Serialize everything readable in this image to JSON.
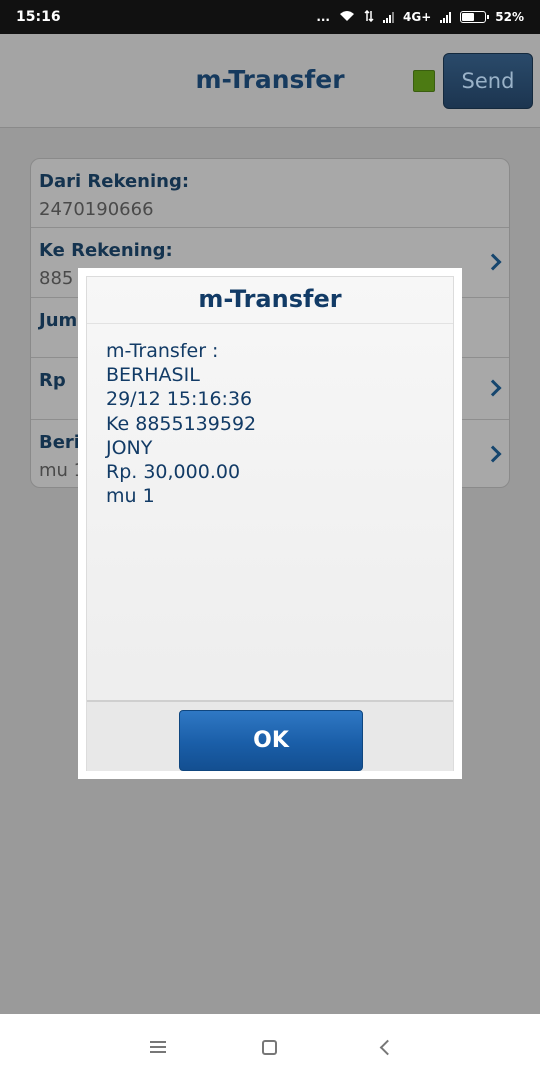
{
  "status_bar": {
    "time": "15:16",
    "dots": "...",
    "network": "4G+",
    "battery": "52%"
  },
  "app": {
    "title": "m-Transfer",
    "send_label": "Send",
    "fields": [
      {
        "label": "Dari Rekening:",
        "value": "2470190666"
      },
      {
        "label": "Ke Rekening:",
        "value": "885"
      },
      {
        "label": "Jum",
        "value": ""
      },
      {
        "label": "Rp",
        "value": ""
      },
      {
        "label": "Berit",
        "value": "mu 1"
      }
    ]
  },
  "dialog": {
    "title": "m-Transfer",
    "message_lines": [
      "m-Transfer :",
      "BERHASIL",
      "29/12 15:16:36",
      "Ke 8855139592",
      "JONY",
      "Rp. 30,000.00",
      "mu 1"
    ],
    "ok_label": "OK"
  },
  "nav_icons": [
    "menu-icon",
    "home-icon",
    "back-icon"
  ]
}
